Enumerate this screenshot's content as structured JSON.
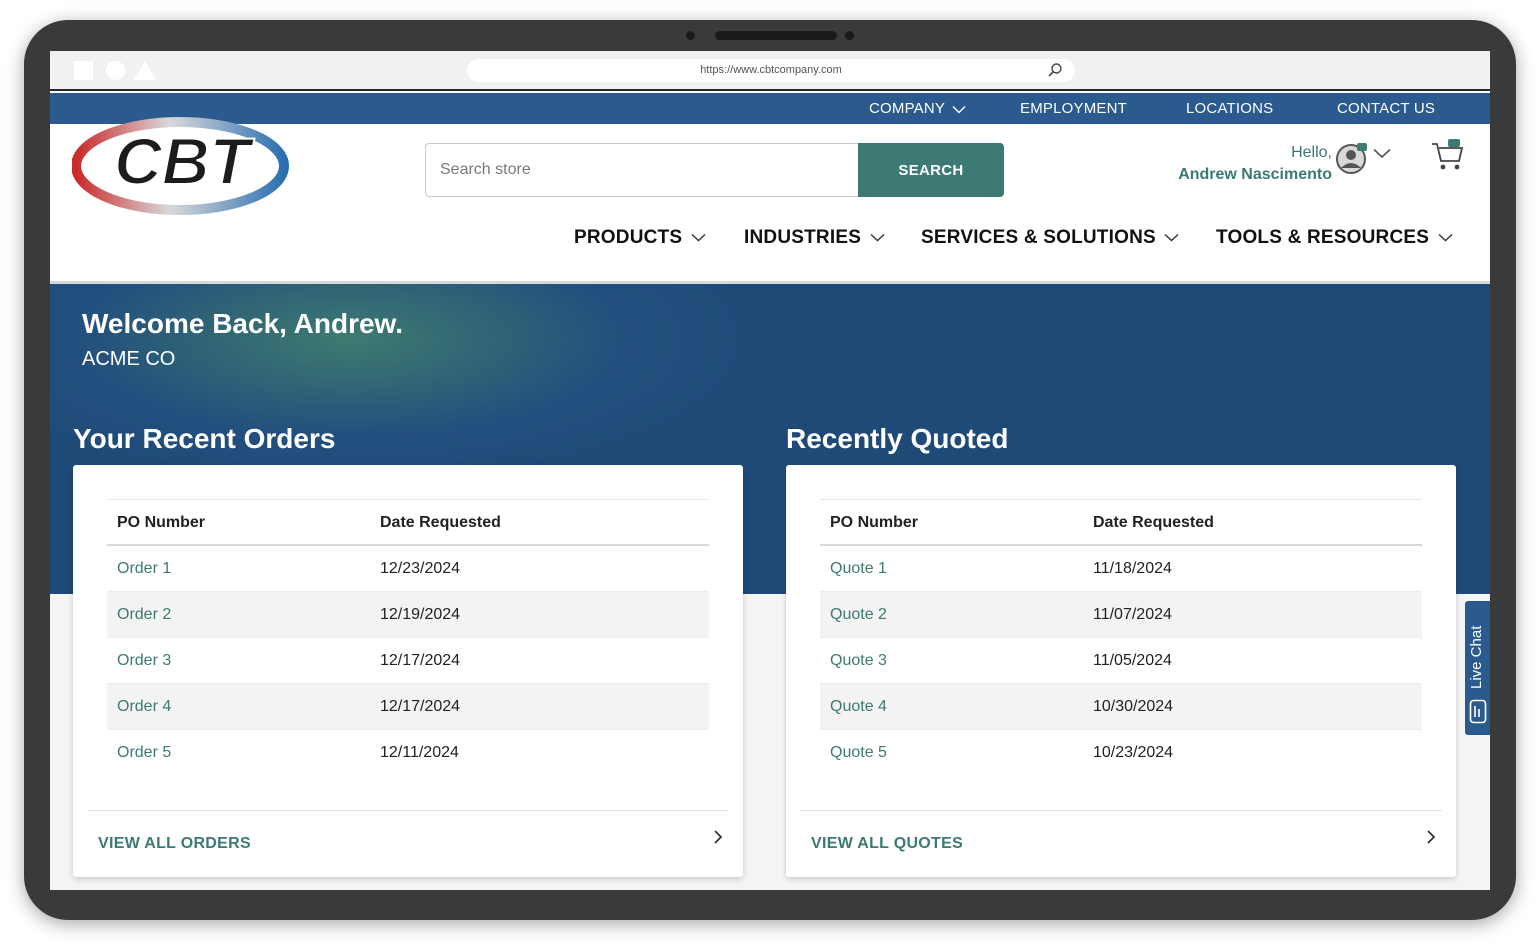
{
  "browser": {
    "url": "https://www.cbtcompany.com"
  },
  "top_nav": {
    "items": [
      {
        "label": "COMPANY",
        "has_dropdown": true
      },
      {
        "label": "EMPLOYMENT",
        "has_dropdown": false
      },
      {
        "label": "LOCATIONS",
        "has_dropdown": false
      },
      {
        "label": "CONTACT US",
        "has_dropdown": false
      }
    ]
  },
  "header": {
    "logo_text": "CBT",
    "search": {
      "placeholder": "Search store",
      "value": "",
      "button_label": "SEARCH"
    },
    "account": {
      "greeting": "Hello,",
      "name": "Andrew Nascimento"
    }
  },
  "main_nav": {
    "items": [
      {
        "label": "PRODUCTS"
      },
      {
        "label": "INDUSTRIES"
      },
      {
        "label": "SERVICES & SOLUTIONS"
      },
      {
        "label": "TOOLS & RESOURCES"
      }
    ]
  },
  "hero": {
    "welcome": "Welcome Back, Andrew.",
    "company": "ACME CO"
  },
  "orders": {
    "title": "Your Recent Orders",
    "columns": [
      "PO Number",
      "Date Requested"
    ],
    "rows": [
      {
        "po": "Order 1",
        "date": "12/23/2024"
      },
      {
        "po": "Order 2",
        "date": "12/19/2024"
      },
      {
        "po": "Order 3",
        "date": "12/17/2024"
      },
      {
        "po": "Order 4",
        "date": "12/17/2024"
      },
      {
        "po": "Order 5",
        "date": "12/11/2024"
      }
    ],
    "view_all": "VIEW ALL ORDERS"
  },
  "quotes": {
    "title": "Recently Quoted",
    "columns": [
      "PO Number",
      "Date Requested"
    ],
    "rows": [
      {
        "po": "Quote 1",
        "date": "11/18/2024"
      },
      {
        "po": "Quote 2",
        "date": "11/07/2024"
      },
      {
        "po": "Quote 3",
        "date": "11/05/2024"
      },
      {
        "po": "Quote 4",
        "date": "10/30/2024"
      },
      {
        "po": "Quote 5",
        "date": "10/23/2024"
      }
    ],
    "view_all": "VIEW ALL QUOTES"
  },
  "live_chat": {
    "label": "Live Chat"
  },
  "colors": {
    "brand_blue": "#2b5b8e",
    "accent_teal": "#3c7a73",
    "hero_dark": "#1f4a78"
  },
  "icons": [
    "search-icon",
    "user-avatar-icon",
    "chevron-down-icon",
    "cart-icon",
    "chevron-right-icon",
    "chat-icon"
  ]
}
